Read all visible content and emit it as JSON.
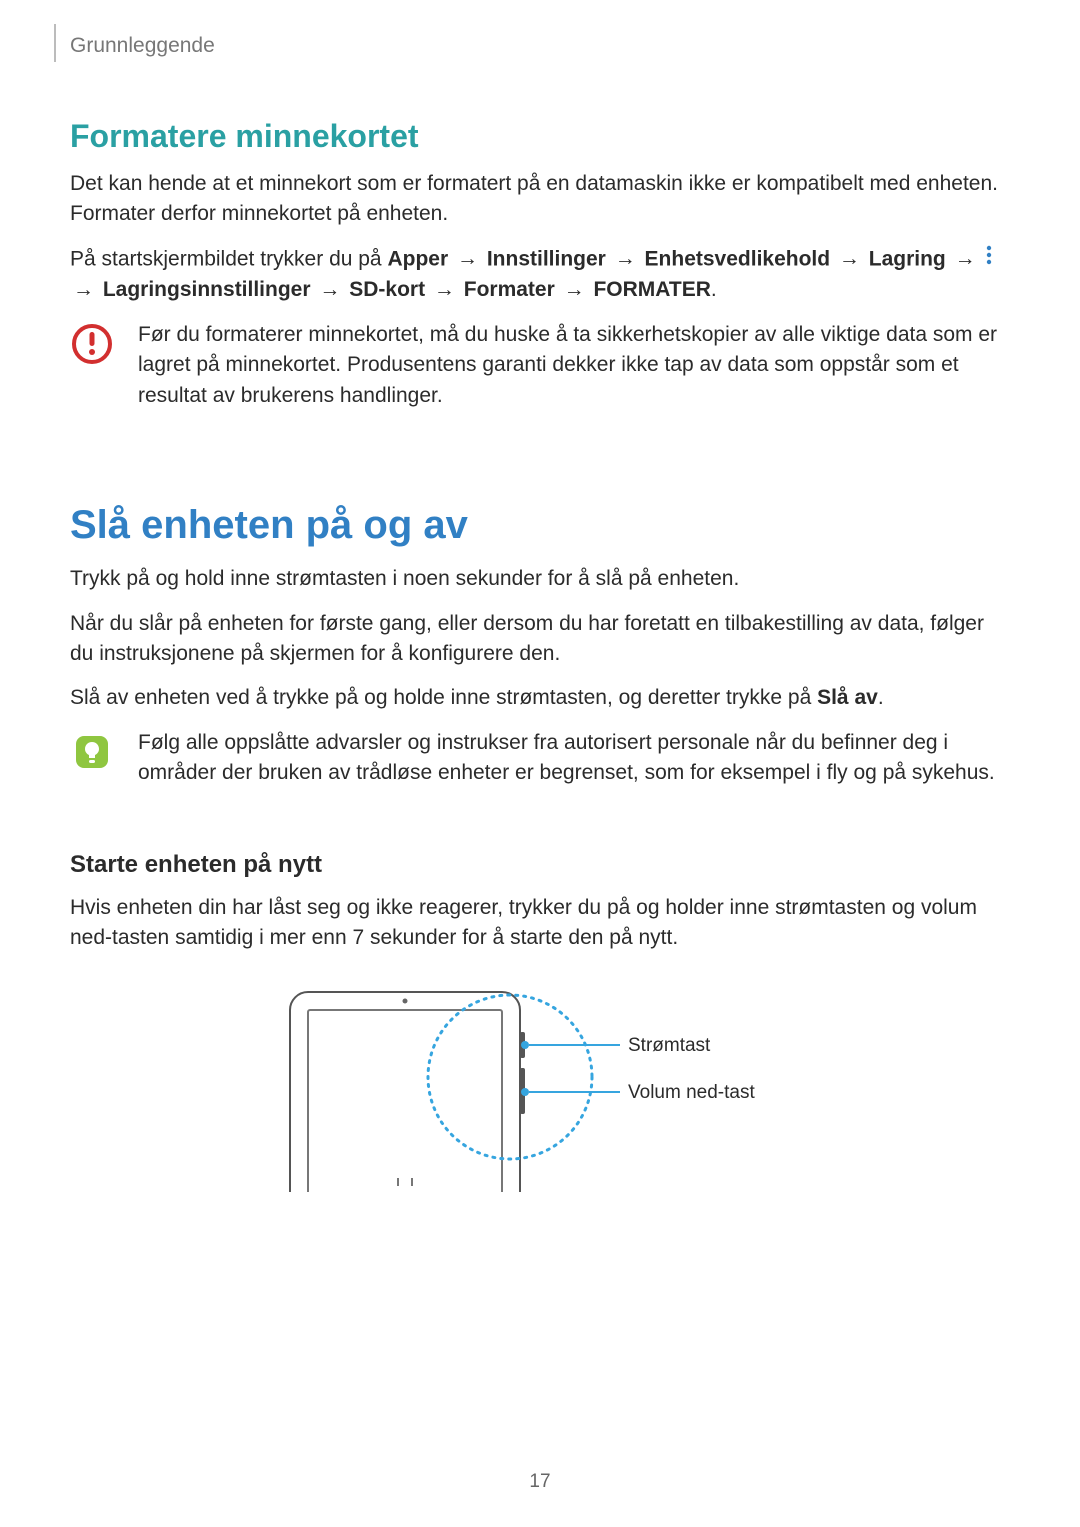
{
  "chapter": "Grunnleggende",
  "h2_format": "Formatere minnekortet",
  "p1": "Det kan hende at et minnekort som er formatert på en datamaskin ikke er kompatibelt med enheten. Formater derfor minnekortet på enheten.",
  "nav": {
    "lead": "På startskjermbildet trykker du på ",
    "s1": "Apper",
    "s2": "Innstillinger",
    "s3": "Enhetsvedlikehold",
    "s4": "Lagring",
    "s5": "Lagringsinnstillinger",
    "s6": "SD-kort",
    "s7": "Formater",
    "s8": "FORMATER",
    "arrow": "→",
    "arrow_lead2": " → "
  },
  "warn_text": "Før du formaterer minnekortet, må du huske å ta sikkerhetskopier av alle viktige data som er lagret på minnekortet. Produsentens garanti dekker ikke tap av data som oppstår som et resultat av brukerens handlinger.",
  "h1_power": "Slå enheten på og av",
  "p2": "Trykk på og hold inne strømtasten i noen sekunder for å slå på enheten.",
  "p3": "Når du slår på enheten for første gang, eller dersom du har foretatt en tilbakestilling av data, følger du instruksjonene på skjermen for å konfigurere den.",
  "p4a": "Slå av enheten ved å trykke på og holde inne strømtasten, og deretter trykke på ",
  "p4b": "Slå av",
  "p4c": ".",
  "info_text": "Følg alle oppslåtte advarsler og instrukser fra autorisert personale når du befinner deg i områder der bruken av trådløse enheter er begrenset, som for eksempel i fly og på sykehus.",
  "h3_restart": "Starte enheten på nytt",
  "p5": "Hvis enheten din har låst seg og ikke reagerer, trykker du på og holder inne strømtasten og volum ned-tasten samtidig i mer enn 7 sekunder for å starte den på nytt.",
  "callout_power": "Strømtast",
  "callout_volume": "Volum ned-tast",
  "pagenum": "17",
  "colors": {
    "teal": "#2aa0a3",
    "blue": "#3180c4",
    "warn": "#d22f2f",
    "info": "#8fc640",
    "callout": "#36a5df"
  }
}
